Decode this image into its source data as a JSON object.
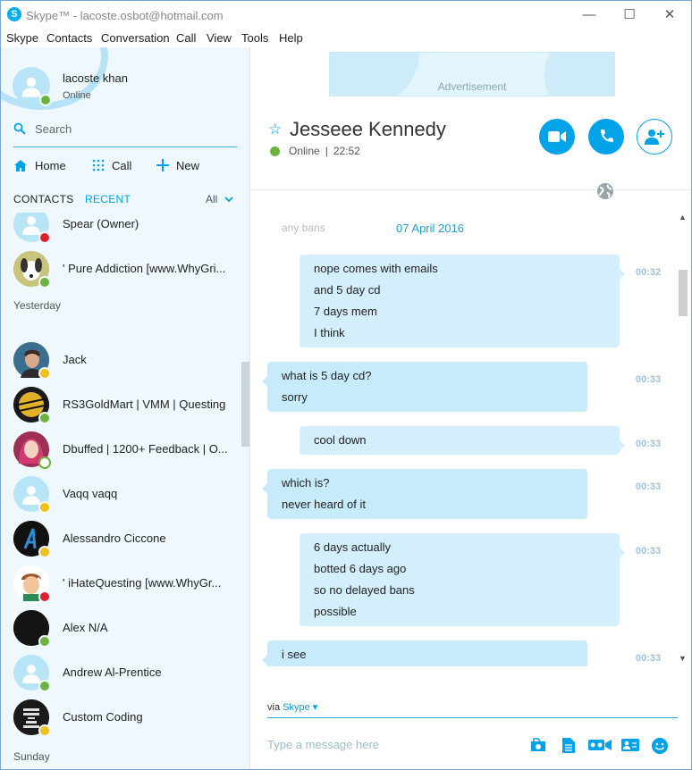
{
  "window": {
    "title": "Skype™ - lacoste.osbot@hotmail.com",
    "app_icon_letter": "S",
    "controls": {
      "minimize": "—",
      "maximize": "☐",
      "close": "✕"
    }
  },
  "menu": [
    "Skype",
    "Contacts",
    "Conversation",
    "Call",
    "View",
    "Tools",
    "Help"
  ],
  "profile": {
    "name": "lacoste khan",
    "status": "Online"
  },
  "search": {
    "placeholder": "Search"
  },
  "nav": {
    "home": "Home",
    "call": "Call",
    "new": "New"
  },
  "tabs": {
    "contacts": "CONTACTS",
    "recent": "RECENT",
    "filter": "All"
  },
  "sections": {
    "yesterday": "Yesterday",
    "sunday": "Sunday"
  },
  "contacts": [
    {
      "name": "Spear (Owner)",
      "status": "dnd",
      "avatar": "default"
    },
    {
      "name": "' Pure Addiction [www.WhyGri...",
      "status": "online",
      "avatar": "dog"
    },
    {
      "name": "Jack",
      "status": "away",
      "avatar": "photo-man"
    },
    {
      "name": "RS3GoldMart | VMM | Questing",
      "status": "online",
      "avatar": "goldmart"
    },
    {
      "name": "Dbuffed | 1200+ Feedback | O...",
      "status": "offline",
      "avatar": "photo-woman"
    },
    {
      "name": "Vaqq vaqq",
      "status": "away",
      "avatar": "default"
    },
    {
      "name": "Alessandro Ciccone",
      "status": "away",
      "avatar": "letter-a"
    },
    {
      "name": "' iHateQuesting [www.WhyGr...",
      "status": "dnd",
      "avatar": "cartoon"
    },
    {
      "name": "Alex N/A",
      "status": "online",
      "avatar": "dark"
    },
    {
      "name": "Andrew Al-Prentice",
      "status": "online",
      "avatar": "default"
    },
    {
      "name": "Custom Coding",
      "status": "away",
      "avatar": "keep-calm"
    }
  ],
  "ad": {
    "label": "Advertisement"
  },
  "conversation": {
    "name": "Jesseee Kennedy",
    "status": "Online",
    "time": "22:52",
    "date": "07 April 2016",
    "faded_text": "any bans"
  },
  "messages": [
    {
      "dir": "out",
      "lines": [
        "nope comes with emails",
        "and 5 day cd",
        "7 days mem",
        "I think"
      ],
      "time": "00:32"
    },
    {
      "dir": "in",
      "lines": [
        "what is 5 day cd?",
        "sorry"
      ],
      "time": "00:33"
    },
    {
      "dir": "out",
      "lines": [
        "cool down"
      ],
      "time": "00:33"
    },
    {
      "dir": "in",
      "lines": [
        "which is?",
        "never heard of it"
      ],
      "time": "00:33"
    },
    {
      "dir": "out",
      "lines": [
        "6 days actually",
        "botted 6 days ago",
        "so no delayed bans",
        "possible"
      ],
      "time": "00:33"
    },
    {
      "dir": "in",
      "lines": [
        "i see"
      ],
      "time": "00:33"
    }
  ],
  "compose": {
    "via_label": "via",
    "via_service": "Skype",
    "placeholder": "Type a message here"
  },
  "colors": {
    "accent": "#00a2e8",
    "bubble_in": "#c7ebfb",
    "bubble_out": "#d3effb",
    "online": "#6cb33e",
    "away": "#f2c014",
    "dnd": "#e0202b"
  }
}
